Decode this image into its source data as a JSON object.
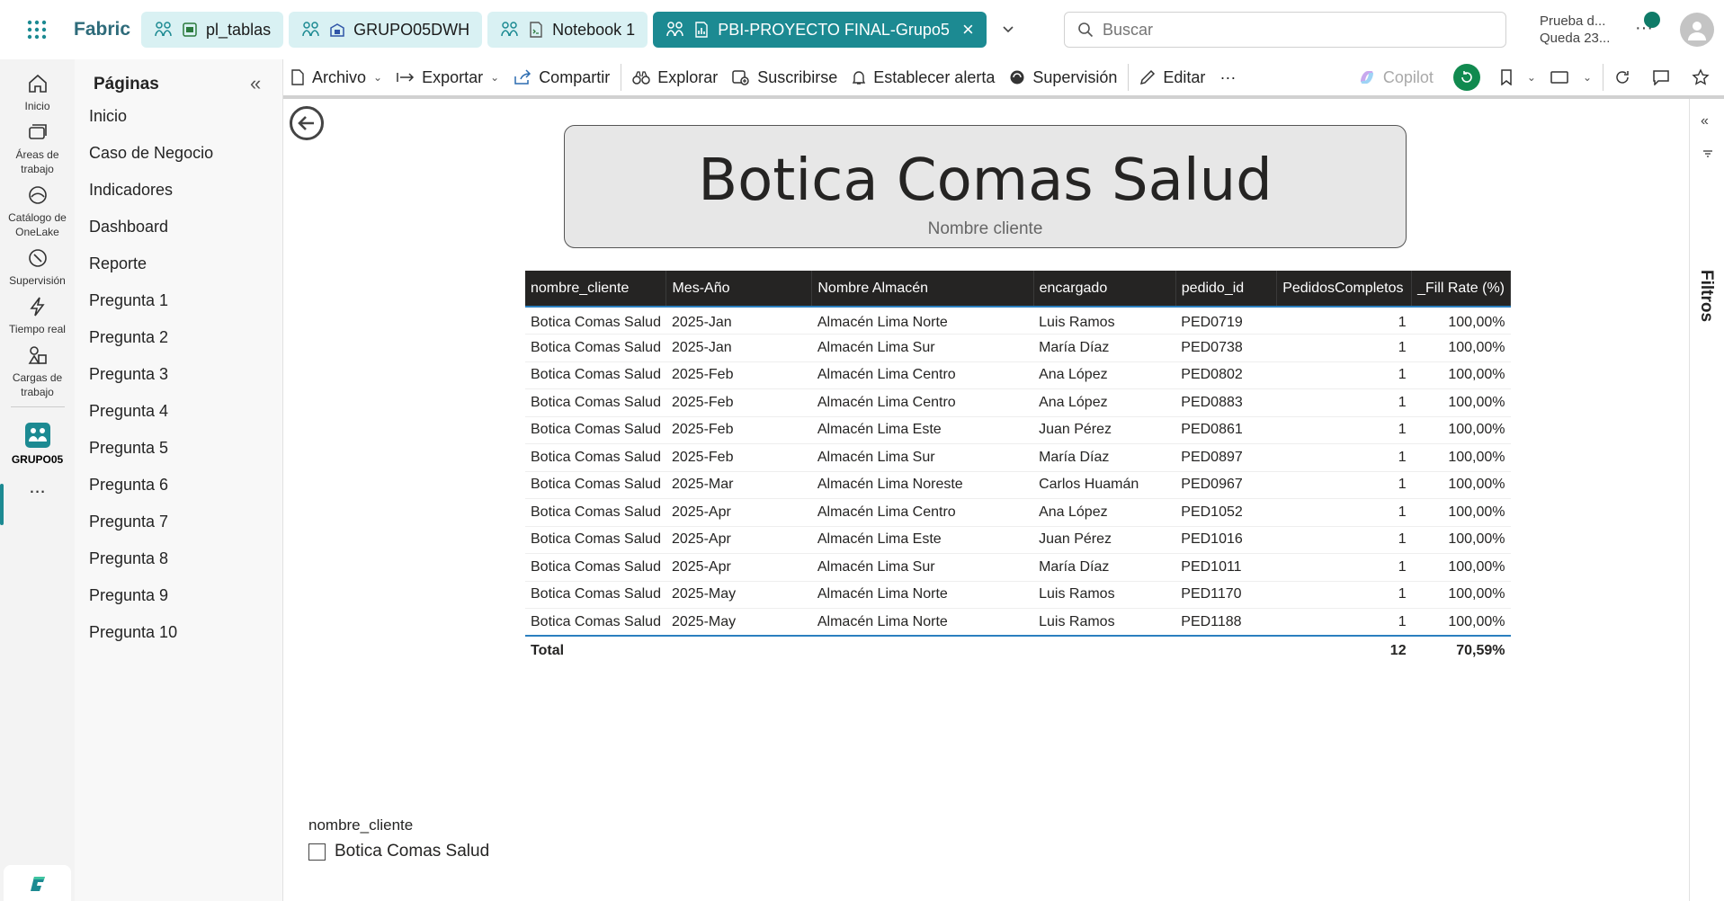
{
  "topbar": {
    "brand": "Fabric",
    "tabs": [
      {
        "label": "pl_tablas",
        "item_icon": "pipeline-icon"
      },
      {
        "label": "GRUPO05DWH",
        "item_icon": "warehouse-icon"
      },
      {
        "label": "Notebook 1",
        "item_icon": "notebook-icon"
      },
      {
        "label": "PBI-PROYECTO FINAL-Grupo5",
        "item_icon": "report-icon",
        "active": true
      }
    ],
    "search_placeholder": "Buscar",
    "trial_line1": "Prueba d...",
    "trial_line2": "Queda 23..."
  },
  "leftnav": {
    "items": [
      {
        "label": "Inicio",
        "icon": "home-icon"
      },
      {
        "label": "Áreas de trabajo",
        "icon": "workspaces-icon"
      },
      {
        "label": "Catálogo de OneLake",
        "icon": "onelake-icon"
      },
      {
        "label": "Supervisión",
        "icon": "monitor-icon"
      },
      {
        "label": "Tiempo real",
        "icon": "lightning-icon"
      },
      {
        "label": "Cargas de trabajo",
        "icon": "workloads-icon"
      },
      {
        "label": "GRUPO05",
        "icon": "workspace-group-icon",
        "active": true
      }
    ],
    "more": "..."
  },
  "pages": {
    "title": "Páginas",
    "items": [
      "Inicio",
      "Caso de Negocio",
      "Indicadores",
      "Dashboard",
      "Reporte",
      "Pregunta 1",
      "Pregunta 2",
      "Pregunta 3",
      "Pregunta 4",
      "Pregunta 5",
      "Pregunta 6",
      "Pregunta 7",
      "Pregunta 8",
      "Pregunta 9",
      "Pregunta 10"
    ]
  },
  "toolbar": {
    "archivo": "Archivo",
    "exportar": "Exportar",
    "compartir": "Compartir",
    "explorar": "Explorar",
    "suscribirse": "Suscribirse",
    "alerta": "Establecer alerta",
    "supervision": "Supervisión",
    "editar": "Editar",
    "more": "···",
    "copilot": "Copilot"
  },
  "rightpane": {
    "filtros": "Filtros"
  },
  "card": {
    "value": "Botica Comas Salud",
    "label": "Nombre cliente"
  },
  "table": {
    "columns": [
      "nombre_cliente",
      "Mes-Año",
      "Nombre Almacén",
      "encargado",
      "pedido_id",
      "PedidosCompletos",
      "_Fill Rate (%)"
    ],
    "rows": [
      [
        "Botica Comas Salud",
        "2025-Jan",
        "Almacén Lima Norte",
        "Luis Ramos",
        "PED0719",
        "1",
        "100,00%"
      ],
      [
        "Botica Comas Salud",
        "2025-Jan",
        "Almacén Lima Sur",
        "María Díaz",
        "PED0738",
        "1",
        "100,00%"
      ],
      [
        "Botica Comas Salud",
        "2025-Feb",
        "Almacén Lima Centro",
        "Ana López",
        "PED0802",
        "1",
        "100,00%"
      ],
      [
        "Botica Comas Salud",
        "2025-Feb",
        "Almacén Lima Centro",
        "Ana López",
        "PED0883",
        "1",
        "100,00%"
      ],
      [
        "Botica Comas Salud",
        "2025-Feb",
        "Almacén Lima Este",
        "Juan Pérez",
        "PED0861",
        "1",
        "100,00%"
      ],
      [
        "Botica Comas Salud",
        "2025-Feb",
        "Almacén Lima Sur",
        "María Díaz",
        "PED0897",
        "1",
        "100,00%"
      ],
      [
        "Botica Comas Salud",
        "2025-Mar",
        "Almacén Lima Noreste",
        "Carlos Huamán",
        "PED0967",
        "1",
        "100,00%"
      ],
      [
        "Botica Comas Salud",
        "2025-Apr",
        "Almacén Lima Centro",
        "Ana López",
        "PED1052",
        "1",
        "100,00%"
      ],
      [
        "Botica Comas Salud",
        "2025-Apr",
        "Almacén Lima Este",
        "Juan Pérez",
        "PED1016",
        "1",
        "100,00%"
      ],
      [
        "Botica Comas Salud",
        "2025-Apr",
        "Almacén Lima Sur",
        "María Díaz",
        "PED1011",
        "1",
        "100,00%"
      ],
      [
        "Botica Comas Salud",
        "2025-May",
        "Almacén Lima Norte",
        "Luis Ramos",
        "PED1170",
        "1",
        "100,00%"
      ],
      [
        "Botica Comas Salud",
        "2025-May",
        "Almacén Lima Norte",
        "Luis Ramos",
        "PED1188",
        "1",
        "100,00%"
      ]
    ],
    "total_label": "Total",
    "total_pedidos": "12",
    "total_fillrate": "70,59%"
  },
  "slicer": {
    "title": "nombre_cliente",
    "option": "Botica Comas Salud",
    "checked": false
  },
  "colors": {
    "accent": "#1c8a92",
    "header_bg": "#252423",
    "reset_green": "#118a4f"
  }
}
